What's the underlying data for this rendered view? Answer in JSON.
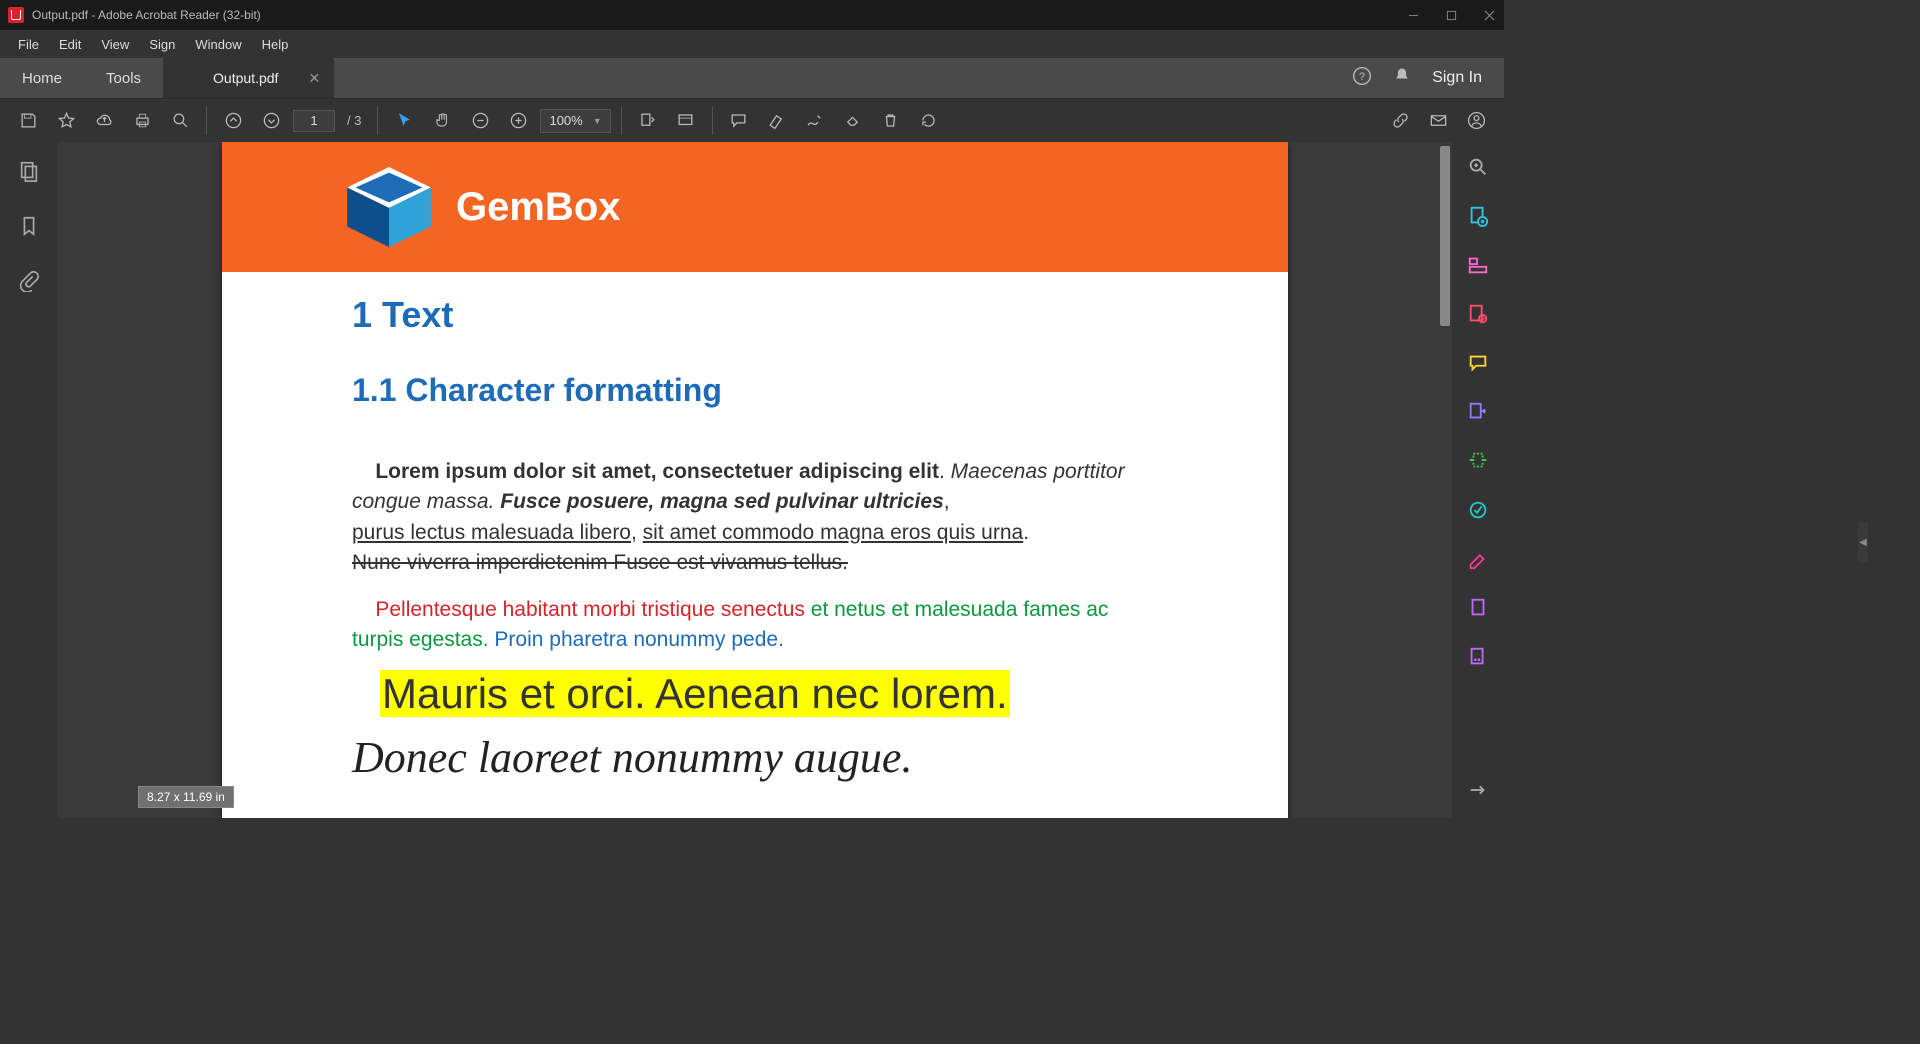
{
  "titlebar": {
    "title": "Output.pdf - Adobe Acrobat Reader (32-bit)"
  },
  "menu": {
    "items": [
      "File",
      "Edit",
      "View",
      "Sign",
      "Window",
      "Help"
    ]
  },
  "tabs": {
    "nav": [
      "Home",
      "Tools"
    ],
    "doc": {
      "label": "Output.pdf"
    },
    "signin": "Sign In"
  },
  "toolbar": {
    "page_current": "1",
    "page_total": "/ 3",
    "zoom": "100%"
  },
  "page_dim": "8.27 x 11.69 in",
  "doc": {
    "brand": "GemBox",
    "h1": "1  Text",
    "h2": "1.1  Character formatting",
    "p1": {
      "a": "Lorem ipsum dolor sit amet, consectetuer adipiscing elit",
      "b": ". ",
      "c": "Maecenas porttitor congue massa. ",
      "d": "Fusce posuere, magna sed pulvinar ultricies",
      "e": ", ",
      "f": "purus lectus malesuada libero",
      "g": ", ",
      "h": "sit amet commodo magna eros quis urna",
      "i": ". ",
      "j": "Nunc viverra imperdietenim Fusce est vivamus tellus."
    },
    "p2": {
      "a": "Pellentesque habitant morbi tristique senectus ",
      "b": "et netus et malesuada fames ac turpis egestas. ",
      "c": "Proin pharetra nonummy pede."
    },
    "hl": "Mauris et orci. Aenean nec lorem.",
    "script": "Donec laoreet nonummy augue."
  }
}
